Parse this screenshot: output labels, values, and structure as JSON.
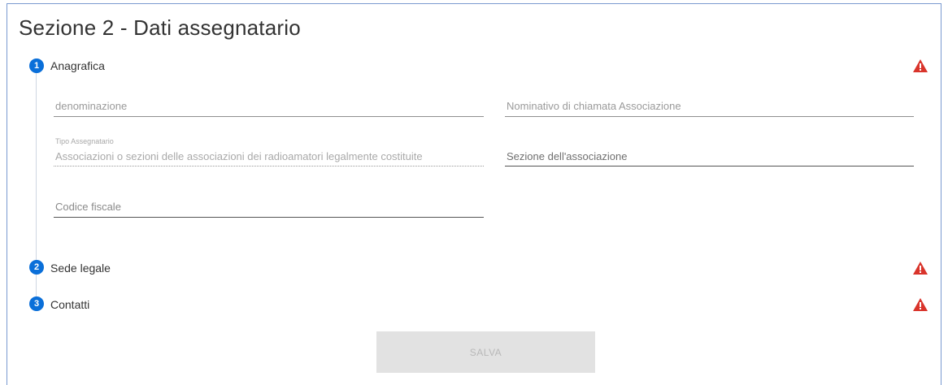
{
  "section": {
    "title": "Sezione 2 - Dati assegnatario"
  },
  "steps": [
    {
      "number": "1",
      "label": "Anagrafica"
    },
    {
      "number": "2",
      "label": "Sede legale"
    },
    {
      "number": "3",
      "label": "Contatti"
    }
  ],
  "form": {
    "denominazione": {
      "placeholder": "denominazione"
    },
    "nominativo": {
      "placeholder": "Nominativo di chiamata Associazione"
    },
    "tipo_assegnatario": {
      "label": "Tipo Assegnatario",
      "value": "Associazioni o sezioni delle associazioni dei radioamatori legalmente costituite"
    },
    "sezione_associazione": {
      "placeholder": "Sezione dell'associazione"
    },
    "codice_fiscale": {
      "placeholder": "Codice fiscale"
    }
  },
  "actions": {
    "save_label": "SALVA"
  },
  "colors": {
    "step_badge": "#0a6fd9",
    "warning": "#d9342b",
    "panel_border": "#7a9ad0"
  },
  "icons": {
    "warning": "warning-triangle-icon"
  }
}
